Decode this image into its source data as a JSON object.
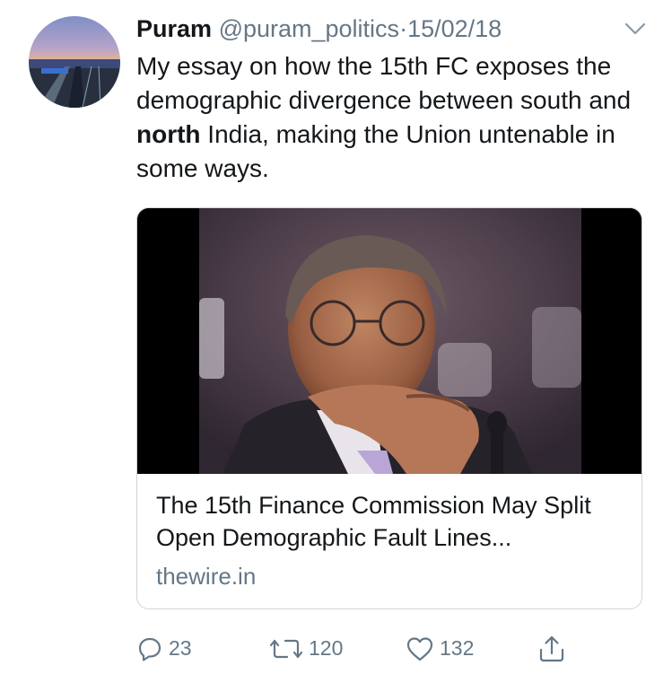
{
  "tweet": {
    "display_name": "Puram",
    "handle": "@puram_politics",
    "separator": "·",
    "date": "15/02/18",
    "text_part1": "My essay on how the 15th FC exposes the demographic divergence between south and ",
    "text_bold": "north",
    "text_part2": " India, making the Union untenable in some ways."
  },
  "card": {
    "title": "The 15th Finance Commission May Split Open Demographic Fault Lines...",
    "domain": "thewire.in"
  },
  "actions": {
    "replies": "23",
    "retweets": "120",
    "likes": "132"
  },
  "icons": {
    "avatar": "avatar-railway-station-photo",
    "menu": "chevron-down-icon",
    "reply": "reply-icon",
    "retweet": "retweet-icon",
    "like": "heart-icon",
    "share": "share-icon"
  },
  "colors": {
    "text": "#14171a",
    "secondary": "#657786",
    "border": "#ccd6dd"
  }
}
